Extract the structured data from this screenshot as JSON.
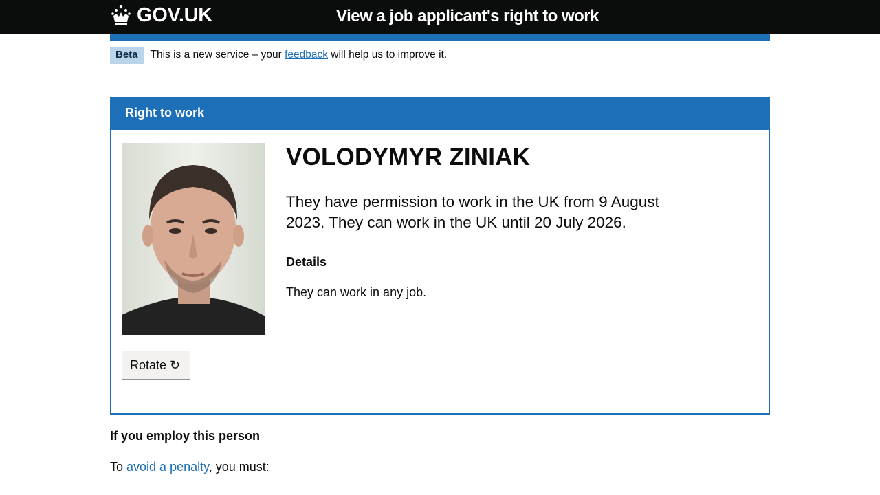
{
  "header": {
    "logo_text": "GOV.UK",
    "service_name": "View a job applicant's right to work"
  },
  "phase_banner": {
    "tag": "Beta",
    "text_before": "This is a new service – your ",
    "link_text": "feedback",
    "text_after": " will help us to improve it."
  },
  "panel": {
    "title": "Right to work",
    "name": "VOLODYMYR ZINIAK",
    "permission": "They have permission to work in the UK from 9 August 2023. They can work in the UK until 20 July 2026.",
    "details_heading": "Details",
    "details_text": "They can work in any job.",
    "rotate_label": "Rotate ↻"
  },
  "employ": {
    "heading": "If you employ this person",
    "text_before": "To ",
    "link_text": "avoid a penalty",
    "text_after": ", you must:"
  },
  "colors": {
    "header_bg": "#0b0c0c",
    "brand_blue": "#1d70b8",
    "phase_tag_bg": "#bbd4ea"
  }
}
